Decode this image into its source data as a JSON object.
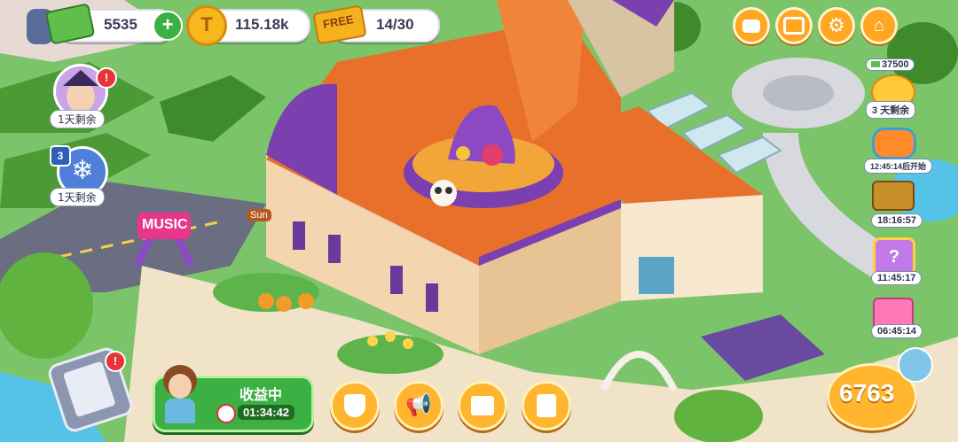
{
  "hud": {
    "cash_value": "5535",
    "hammer_value": "115.18k",
    "free_label": "FREE",
    "progress_value": "14/30"
  },
  "left_events": {
    "witch_timer": "1天剩余",
    "snow_level": "3",
    "snow_timer": "1天剩余"
  },
  "right_side": {
    "piggy_amount": "37500",
    "piggy_timer": "3 天剩余",
    "pool_timer": "12:45:14后开始",
    "chest_timer": "18:16:57",
    "quiz_badge": "?",
    "quiz_timer": "11:45:17",
    "gift_timer": "06:45:14"
  },
  "bottom": {
    "earning_label": "收益中",
    "earning_timer": "01:34:42",
    "score_value": "6763"
  },
  "scene": {
    "music_sign": "MUSIC",
    "sun_sign": "Sun"
  },
  "colors": {
    "roof_orange": "#e8702a",
    "purple": "#7b3fb0",
    "grass": "#7cc46a",
    "hud_orange": "#ffa623",
    "green_button": "#3cb043"
  }
}
